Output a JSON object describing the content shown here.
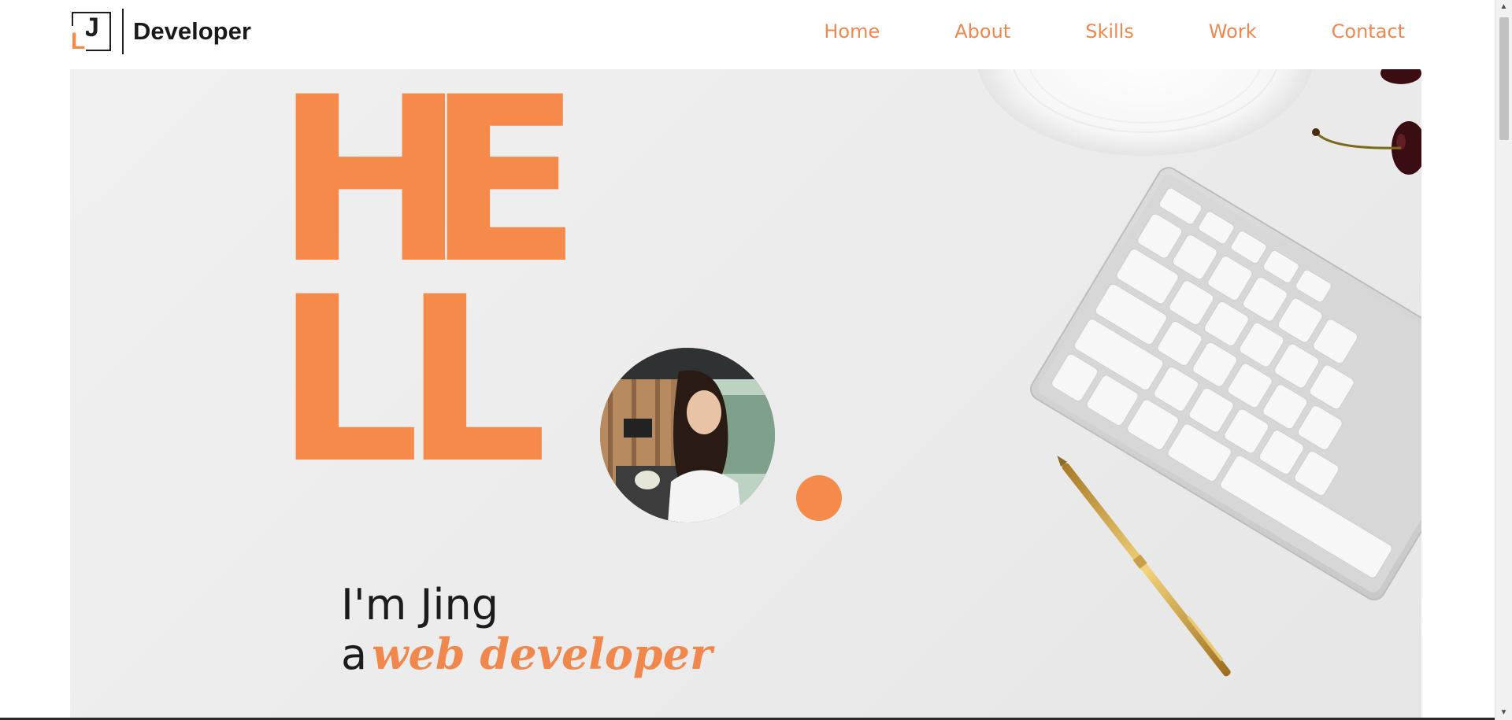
{
  "brand": {
    "mark_letter": "J",
    "mark_corner_letter": "L",
    "name": "Developer"
  },
  "nav": {
    "items": [
      {
        "label": "Home"
      },
      {
        "label": "About"
      },
      {
        "label": "Skills"
      },
      {
        "label": "Work"
      },
      {
        "label": "Contact"
      }
    ]
  },
  "hero": {
    "hello_letters": [
      "H",
      "E",
      "L",
      "L"
    ],
    "greeting_line": "I'm Jing",
    "role_prefix": "a",
    "role_highlight": "web developer"
  },
  "colors": {
    "accent": "#f68a4a",
    "text": "#1c1c1c",
    "background": "#ececec"
  },
  "icons": {
    "scroll_up": "triangle-up",
    "scroll_down": "triangle-down"
  }
}
